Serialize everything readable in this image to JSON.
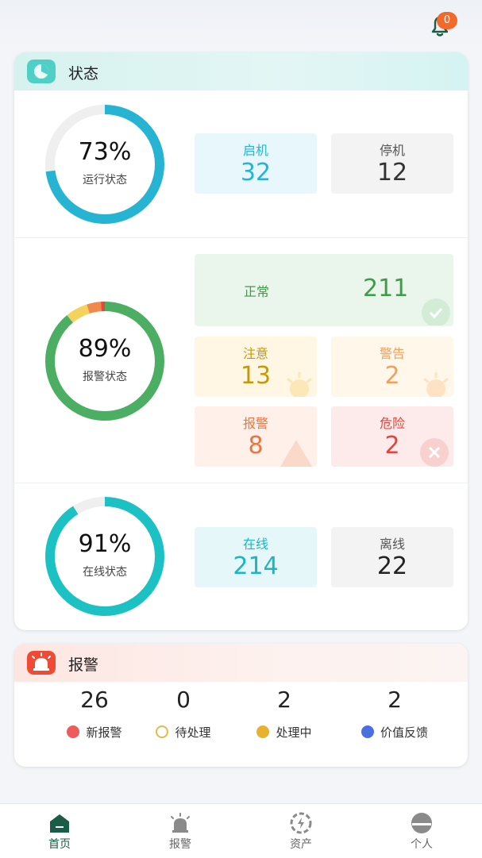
{
  "header": {
    "notification_count": "0"
  },
  "status_card": {
    "title": "状态",
    "running": {
      "percent": 73,
      "percent_text": "73%",
      "label": "运行状态",
      "tiles": [
        {
          "label": "启机",
          "value": "32"
        },
        {
          "label": "停机",
          "value": "12"
        }
      ]
    },
    "alarm_state": {
      "percent": 89,
      "percent_text": "89%",
      "label": "报警状态",
      "normal": {
        "label": "正常",
        "value": "211"
      },
      "tiles": [
        {
          "label": "注意",
          "value": "13"
        },
        {
          "label": "警告",
          "value": "2"
        },
        {
          "label": "报警",
          "value": "8"
        },
        {
          "label": "危险",
          "value": "2"
        }
      ]
    },
    "online": {
      "percent": 91,
      "percent_text": "91%",
      "label": "在线状态",
      "tiles": [
        {
          "label": "在线",
          "value": "214"
        },
        {
          "label": "离线",
          "value": "22"
        }
      ]
    }
  },
  "alarm_card": {
    "title": "报警",
    "stats": [
      {
        "value": "26",
        "label": "新报警",
        "icon": "message-icon"
      },
      {
        "value": "0",
        "label": "待处理",
        "icon": "clock-icon"
      },
      {
        "value": "2",
        "label": "处理中",
        "icon": "wrench-icon"
      },
      {
        "value": "2",
        "label": "价值反馈",
        "icon": "database-icon"
      }
    ]
  },
  "tabbar": {
    "items": [
      {
        "label": "首页",
        "icon": "home-icon",
        "active": true
      },
      {
        "label": "报警",
        "icon": "siren-icon",
        "active": false
      },
      {
        "label": "资产",
        "icon": "asset-icon",
        "active": false
      },
      {
        "label": "个人",
        "icon": "user-icon",
        "active": false
      }
    ]
  },
  "colors": {
    "accent": "#1a5c46",
    "cyan": "#27b4d3",
    "green": "#4caf50",
    "teal": "#1cc1c4",
    "yellow_text": "#c89a00",
    "orange_text": "#f0a060",
    "red_text": "#e2553c"
  }
}
